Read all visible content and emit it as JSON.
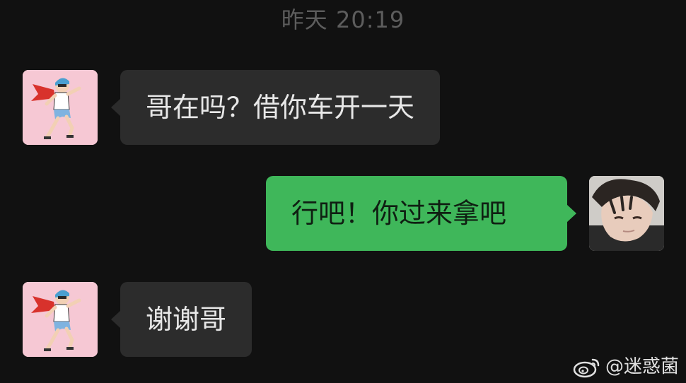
{
  "chat": {
    "timestamp": "昨天 20:19",
    "messages": [
      {
        "sender": "friend",
        "text": "哥在吗？借你车开一天",
        "avatar_icon": "caped-hero-avatar-icon"
      },
      {
        "sender": "self",
        "text": "行吧！你过来拿吧",
        "avatar_icon": "boy-photo-avatar-icon"
      },
      {
        "sender": "friend",
        "text": "谢谢哥",
        "avatar_icon": "caped-hero-avatar-icon"
      }
    ]
  },
  "watermark": {
    "text": "@迷惑菌",
    "icon": "weibo-logo-icon"
  },
  "colors": {
    "background": "#111111",
    "incoming_bubble": "#2c2c2c",
    "outgoing_bubble": "#3fb75a",
    "timestamp_text": "#5d5d5d"
  }
}
